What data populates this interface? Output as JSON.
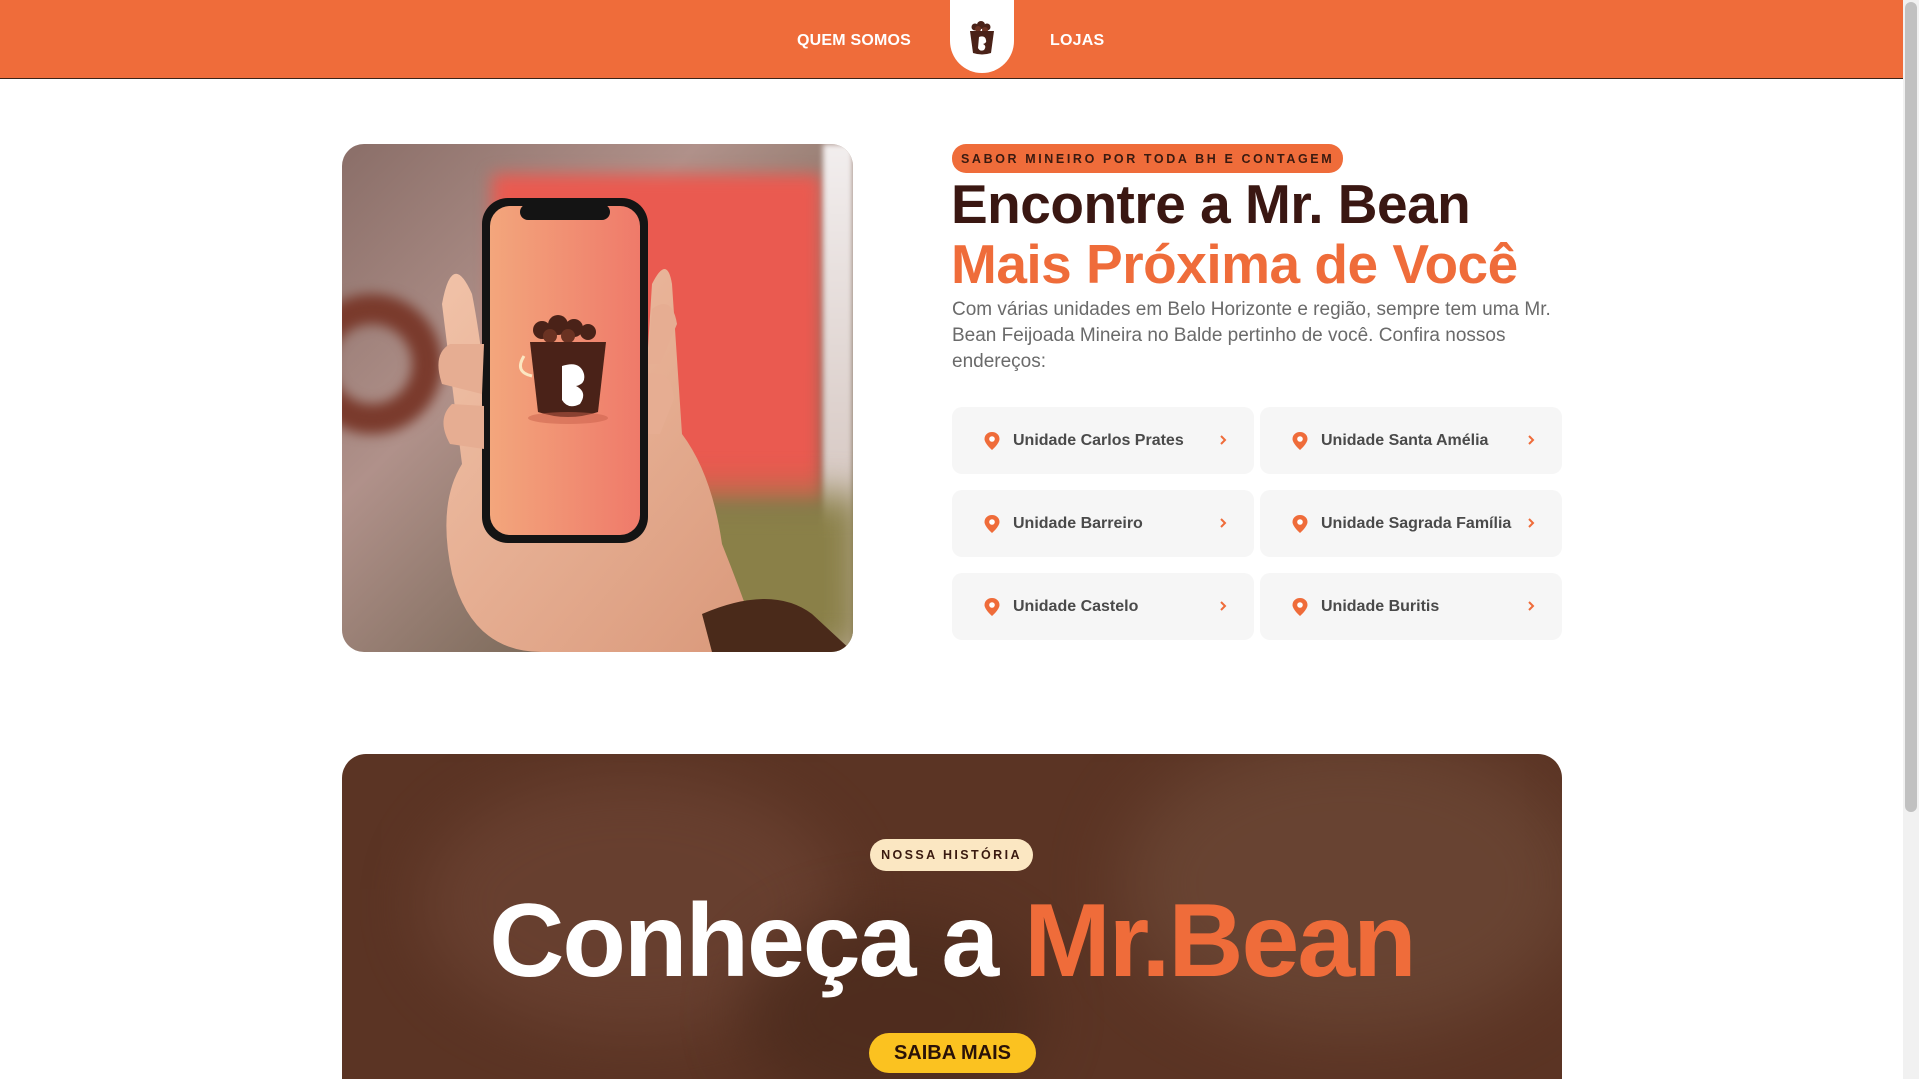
{
  "header": {
    "nav_left": "QUEM SOMOS",
    "nav_right": "LOJAS",
    "logo_icon": "bean-bucket-logo-icon",
    "accent_color": "#ef6c3a"
  },
  "hero": {
    "tag": "SABOR MINEIRO POR TODA BH E CONTAGEM",
    "title_line1": "Encontre a Mr. Bean",
    "title_line2": "Mais Próxima de Você",
    "description": "Com várias unidades em Belo Horizonte e região, sempre tem uma Mr. Bean Feijoada Mineira no Balde pertinho de você. Confira nossos endereços:",
    "image_icon": "hand-holding-phone-image"
  },
  "stores": [
    {
      "label": "Unidade Carlos Prates"
    },
    {
      "label": "Unidade Santa Amélia"
    },
    {
      "label": "Unidade Barreiro"
    },
    {
      "label": "Unidade Sagrada Família"
    },
    {
      "label": "Unidade Castelo"
    },
    {
      "label": "Unidade Buritis"
    }
  ],
  "story": {
    "tag": "NOSSA HISTÓRIA",
    "title_white": "Conheça a ",
    "title_orange": "Mr.Bean",
    "button": "SAIBA MAIS",
    "background_color": "#5b3424",
    "button_color": "#fbc220"
  }
}
